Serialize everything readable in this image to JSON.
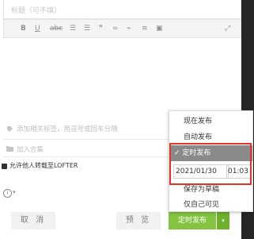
{
  "editor": {
    "title_placeholder": "标题（可不填）",
    "toolbar": {
      "bold": "B",
      "underline": "U",
      "strike": "abc",
      "ordered_list": "☰",
      "unordered_list": "☰",
      "quote": "❞",
      "link": "∞",
      "unlink": "⌁",
      "hr": "≡",
      "image": "▣",
      "fullscreen": "⤢"
    },
    "tag_placeholder": "添加相关标签，用逗号或回车分隔",
    "collection_placeholder": "加入合集",
    "allow_repost_label": "允许他人转载至LOFTER",
    "allow_repost_checked": true
  },
  "footer": {
    "cancel_label": "取 消",
    "preview_label": "预 览",
    "publish_label": "定时发布"
  },
  "publish_menu": {
    "items": [
      {
        "label": "现在发布"
      },
      {
        "label": "自动发布"
      },
      {
        "label": "定时发布",
        "selected": true
      },
      {
        "label": "保存为草稿"
      },
      {
        "label": "仅自己可见"
      }
    ],
    "schedule_date": "2021/01/30",
    "schedule_time": "01:03"
  },
  "colors": {
    "accent": "#84c440",
    "selected_bg": "#8a8a8a",
    "highlight": "#e5332a"
  }
}
